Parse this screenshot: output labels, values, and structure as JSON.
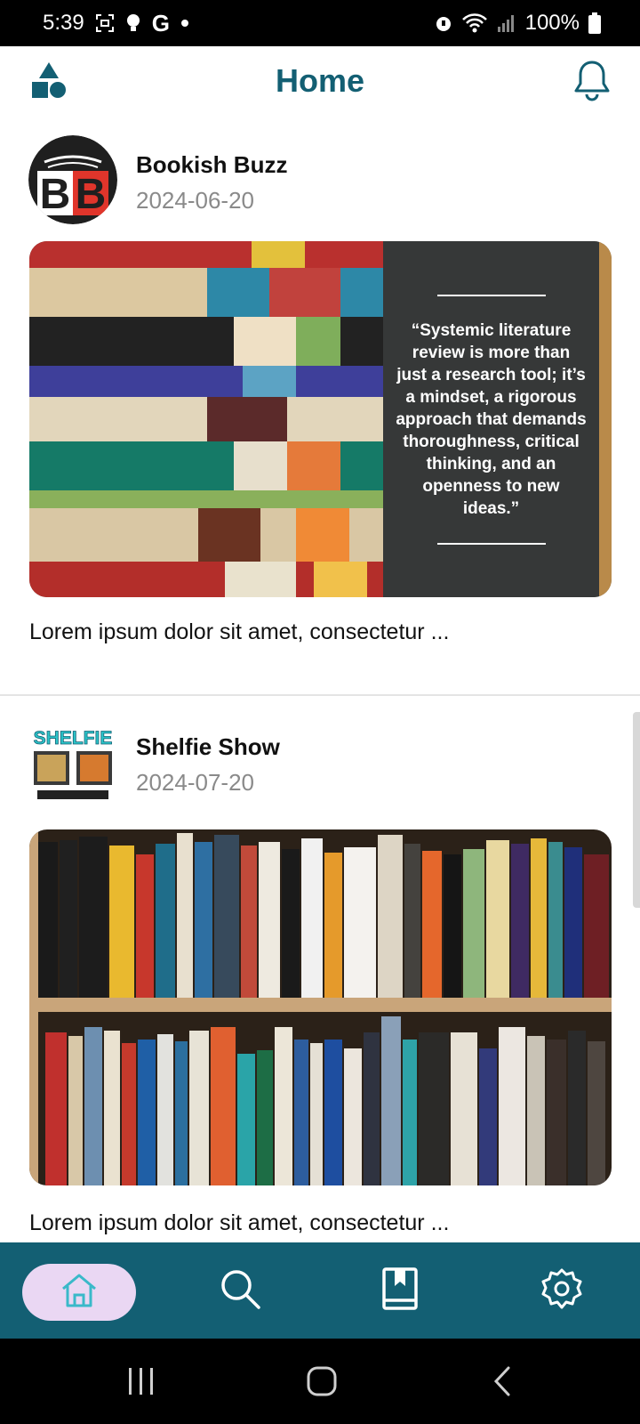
{
  "status_bar": {
    "time": "5:39",
    "g_label": "G",
    "battery_text": "100%",
    "icons": [
      "screenshot-icon",
      "bulb-icon",
      "google-icon",
      "dot-icon",
      "alarm-icon",
      "wifi-icon",
      "signal-icon",
      "battery-icon"
    ]
  },
  "header": {
    "title": "Home",
    "left_icon": "shapes-icon",
    "right_icon": "bell-icon"
  },
  "posts": [
    {
      "author": "Bookish Buzz",
      "date": "2024-06-20",
      "avatar_letters": "BB",
      "image_quote": "“Systemic literature review is more than just a research tool; it’s a mindset, a rigorous approach that demands thoroughness, critical thinking, and an openness to new ideas.”",
      "excerpt": "Lorem ipsum dolor sit amet, consectetur ..."
    },
    {
      "author": "Shelfie Show",
      "date": "2024-07-20",
      "avatar_logo_text": "SHELFIE",
      "excerpt": "Lorem ipsum dolor sit amet, consectetur ..."
    }
  ],
  "bottom_nav": {
    "items": [
      "home-icon",
      "search-icon",
      "bookmark-book-icon",
      "settings-gear-icon"
    ],
    "active": "home-icon"
  },
  "system_nav": {
    "items": [
      "recents-icon",
      "home-circle-icon",
      "back-icon"
    ]
  },
  "colors": {
    "brand": "#135f73",
    "active_pill": "#ead7f3",
    "quote_panel": "#363838"
  }
}
